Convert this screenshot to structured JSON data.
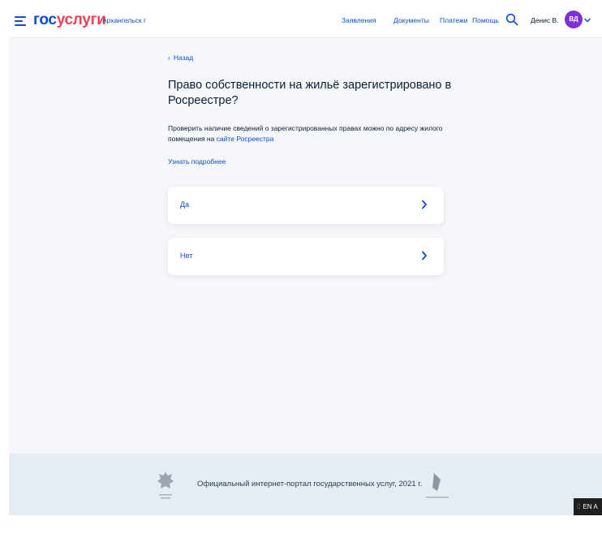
{
  "header": {
    "logo_part1": "гос",
    "logo_part2": "услуги",
    "city": "Архангельск г",
    "nav": [
      "Заявления",
      "Документы",
      "Платежи",
      "Помощь"
    ],
    "user_name": "Денис В.",
    "avatar_initials": "ВД",
    "colors": {
      "accent": "#0d4cd3",
      "logo_red": "#ee3f58",
      "avatar": "#7f2fd7"
    }
  },
  "main": {
    "back_label": "Назад",
    "title": "Право собственности на жильё зарегистрировано в Росреестре?",
    "desc_text": "Проверить наличие сведений о зарегистрированных правах можно по адресу жилого помещения на ",
    "desc_link": "сайте Росреестра",
    "more_link": "Узнать подробнее",
    "options": [
      {
        "label": "Да"
      },
      {
        "label": "Нет"
      }
    ]
  },
  "footer": {
    "text": "Официальный интернет-портал государственных услуг, 2021 г."
  },
  "taskbar": {
    "lang": "EN A"
  }
}
